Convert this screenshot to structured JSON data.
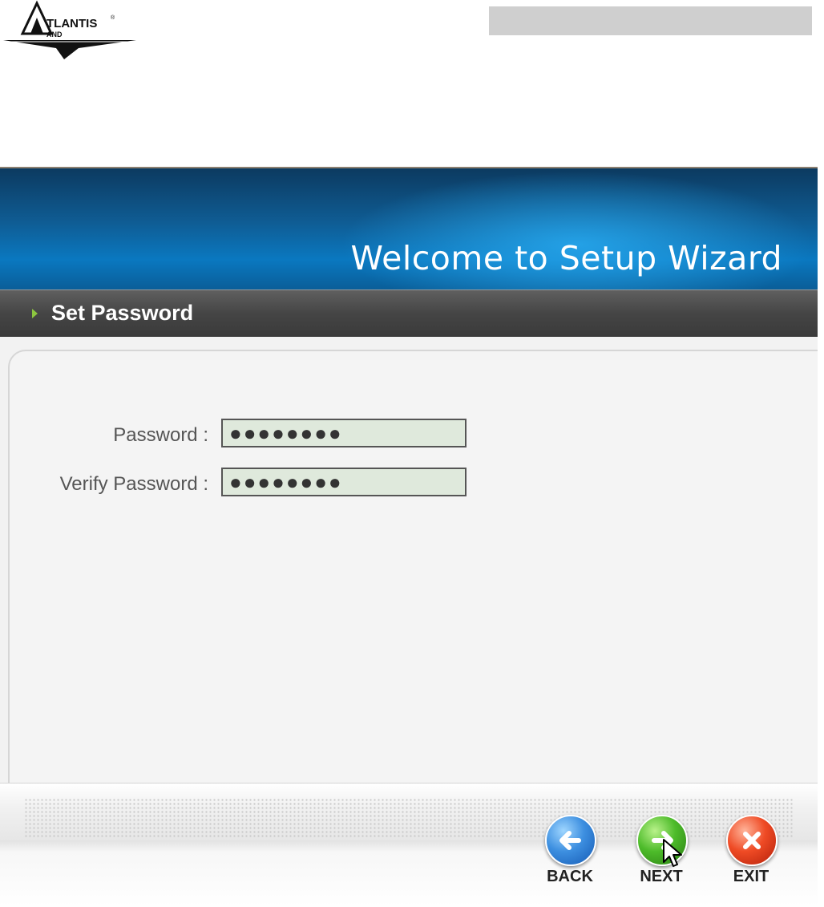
{
  "header": {
    "logo_text": "ATLANTIS AND"
  },
  "wizard": {
    "banner_title": "Welcome to Setup Wizard",
    "section_title": "Set Password",
    "form": {
      "password_label": "Password :",
      "password_value": "●●●●●●●●",
      "verify_label": "Verify Password :",
      "verify_value": "●●●●●●●●"
    },
    "buttons": {
      "back": "BACK",
      "next": "NEXT",
      "exit": "EXIT"
    }
  },
  "colors": {
    "banner_blue": "#0a78c0",
    "section_bar": "#454545",
    "input_fill": "#dfe9dc",
    "arrow_green": "#8cc63f"
  },
  "icons": [
    "atlantis-logo-icon",
    "triangle-bullet-icon",
    "back-arrow-icon",
    "next-arrow-icon",
    "exit-x-icon",
    "mouse-pointer-icon"
  ]
}
